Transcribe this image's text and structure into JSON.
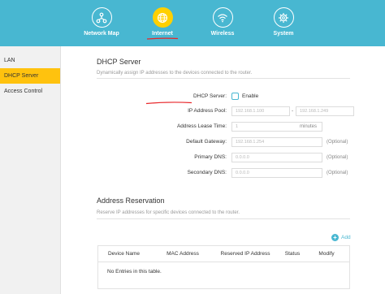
{
  "nav": {
    "items": [
      {
        "label": "Network Map",
        "icon": "network-map-icon"
      },
      {
        "label": "Internet",
        "icon": "globe-icon",
        "active": true
      },
      {
        "label": "Wireless",
        "icon": "wifi-icon"
      },
      {
        "label": "System",
        "icon": "gear-icon"
      }
    ]
  },
  "sidebar": {
    "items": [
      {
        "label": "LAN"
      },
      {
        "label": "DHCP Server",
        "active": true
      },
      {
        "label": "Access Control"
      }
    ]
  },
  "dhcp": {
    "title": "DHCP Server",
    "subtitle": "Dynamically assign IP addresses to the devices connected to the router.",
    "server_label": "DHCP Server:",
    "enable_label": "Enable",
    "enabled": false,
    "pool_label": "IP Address Pool:",
    "pool_start": "192.168.1.100",
    "pool_separator": "-",
    "pool_end": "192.168.1.249",
    "lease_label": "Address Lease Time:",
    "lease_value": "1",
    "lease_unit": "minutes",
    "gateway_label": "Default Gateway:",
    "gateway_value": "192.168.1.254",
    "primary_dns_label": "Primary DNS:",
    "primary_dns_value": "0.0.0.0",
    "secondary_dns_label": "Secondary DNS:",
    "secondary_dns_value": "0.0.0.0",
    "optional_text": "(Optional)"
  },
  "reservation": {
    "title": "Address Reservation",
    "subtitle": "Reserve IP addresses for specific devices connected to the router.",
    "add_label": "Add",
    "columns": [
      "Device Name",
      "MAC Address",
      "Reserved IP Address",
      "Status",
      "Modify"
    ],
    "empty_text": "No Entries in this table."
  },
  "colors": {
    "header": "#48b7d1",
    "active_tab": "#ffd000",
    "sidebar_active": "#ffc20e",
    "annotation_red": "#e8262a"
  }
}
